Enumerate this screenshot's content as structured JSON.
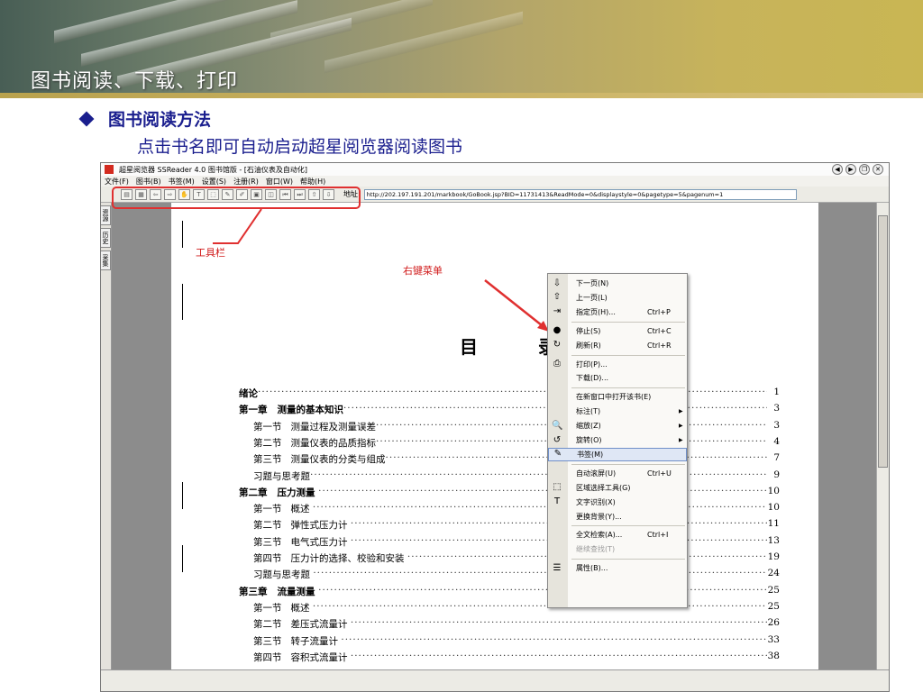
{
  "slide": {
    "banner_title": "图书阅读、下载、打印",
    "heading": "图书阅读方法",
    "subheading": "点击书名即可自动启动超星阅览器阅读图书"
  },
  "app": {
    "title": "超星阅览器 SSReader 4.0 图书馆版 - [石油仪表及自动化]",
    "menu": [
      "文件(F)",
      "图书(B)",
      "书签(M)",
      "设置(S)",
      "注册(R)",
      "窗口(W)",
      "帮助(H)"
    ],
    "address_label": "地址:",
    "address_value": "http://202.197.191.201/markbook/GoBook.jsp?BID=11731413&ReadMode=0&displaystyle=0&pagetype=5&pagenum=1",
    "side_tabs": [
      "资源",
      "历史",
      "采集"
    ]
  },
  "page": {
    "contents_title": "目 录",
    "toc": [
      {
        "text": "绪论",
        "page": "1",
        "level": "chapter"
      },
      {
        "text": "第一章   测量的基本知识",
        "page": "3",
        "level": "chapter"
      },
      {
        "text": "第一节   测量过程及测量误差",
        "page": "3",
        "level": "section"
      },
      {
        "text": "第二节   测量仪表的品质指标",
        "page": "4",
        "level": "section"
      },
      {
        "text": "第三节   测量仪表的分类与组成",
        "page": "7",
        "level": "section"
      },
      {
        "text": "习题与思考题",
        "page": "9",
        "level": "section"
      },
      {
        "text": "第二章   压力测量 ",
        "page": "10",
        "level": "chapter"
      },
      {
        "text": "第一节   概述 ",
        "page": "10",
        "level": "section"
      },
      {
        "text": "第二节   弹性式压力计 ",
        "page": "11",
        "level": "section"
      },
      {
        "text": "第三节   电气式压力计 ",
        "page": "13",
        "level": "section"
      },
      {
        "text": "第四节   压力计的选择、校验和安装 ",
        "page": "19",
        "level": "section"
      },
      {
        "text": "习题与思考题 ",
        "page": "24",
        "level": "section"
      },
      {
        "text": "第三章   流量测量 ",
        "page": "25",
        "level": "chapter"
      },
      {
        "text": "第一节   概述 ",
        "page": "25",
        "level": "section"
      },
      {
        "text": "第二节   差压式流量计 ",
        "page": "26",
        "level": "section"
      },
      {
        "text": "第三节   转子流量计 ",
        "page": "33",
        "level": "section"
      },
      {
        "text": "第四节   容积式流量计 ",
        "page": "38",
        "level": "section"
      }
    ]
  },
  "annotations": {
    "toolbar_label": "工具栏",
    "context_menu_label": "右键菜单"
  },
  "context_menu": [
    {
      "label": "下一页(N)",
      "shortcut": "",
      "icon": "arrow-down-icon",
      "glyph": "⇩"
    },
    {
      "label": "上一页(L)",
      "shortcut": "",
      "icon": "arrow-up-icon",
      "glyph": "⇧"
    },
    {
      "label": "指定页(H)...",
      "shortcut": "Ctrl+P",
      "icon": "goto-page-icon",
      "glyph": "⇥"
    },
    {
      "sep": true
    },
    {
      "label": "停止(S)",
      "shortcut": "Ctrl+C",
      "icon": "stop-icon",
      "glyph": "●"
    },
    {
      "label": "刷新(R)",
      "shortcut": "Ctrl+R",
      "icon": "refresh-icon",
      "glyph": "↻"
    },
    {
      "sep": true
    },
    {
      "label": "打印(P)...",
      "shortcut": "",
      "icon": "printer-icon",
      "glyph": "⎙"
    },
    {
      "label": "下载(D)...",
      "shortcut": "",
      "icon": "",
      "glyph": ""
    },
    {
      "sep": true
    },
    {
      "label": "在新窗口中打开该书(E)",
      "shortcut": "",
      "icon": "",
      "glyph": ""
    },
    {
      "label": "标注(T)",
      "shortcut": "",
      "icon": "",
      "glyph": "",
      "submenu": true
    },
    {
      "label": "缩放(Z)",
      "shortcut": "",
      "icon": "zoom-icon",
      "glyph": "🔍",
      "submenu": true
    },
    {
      "label": "旋转(O)",
      "shortcut": "",
      "icon": "rotate-icon",
      "glyph": "↺",
      "submenu": true
    },
    {
      "label": "书签(M)",
      "shortcut": "",
      "icon": "bookmark-icon",
      "glyph": "✎",
      "highlight": true
    },
    {
      "sep": true
    },
    {
      "label": "自动滚屏(U)",
      "shortcut": "Ctrl+U",
      "icon": "",
      "glyph": ""
    },
    {
      "label": "区域选择工具(G)",
      "shortcut": "",
      "icon": "region-select-icon",
      "glyph": "⬚"
    },
    {
      "label": "文字识别(X)",
      "shortcut": "",
      "icon": "ocr-text-icon",
      "glyph": "T"
    },
    {
      "label": "更换背景(Y)...",
      "shortcut": "",
      "icon": "",
      "glyph": ""
    },
    {
      "sep": true
    },
    {
      "label": "全文检索(A)...",
      "shortcut": "Ctrl+I",
      "icon": "",
      "glyph": ""
    },
    {
      "label": "继续查找(T)",
      "shortcut": "",
      "icon": "",
      "glyph": "",
      "disabled": true
    },
    {
      "sep": true
    },
    {
      "label": "属性(B)...",
      "shortcut": "",
      "icon": "properties-icon",
      "glyph": "☰"
    }
  ],
  "colors": {
    "heading_text": "#1a1e8e",
    "annotation_red": "#e03030",
    "viewer_background": "#8c8c8c"
  }
}
